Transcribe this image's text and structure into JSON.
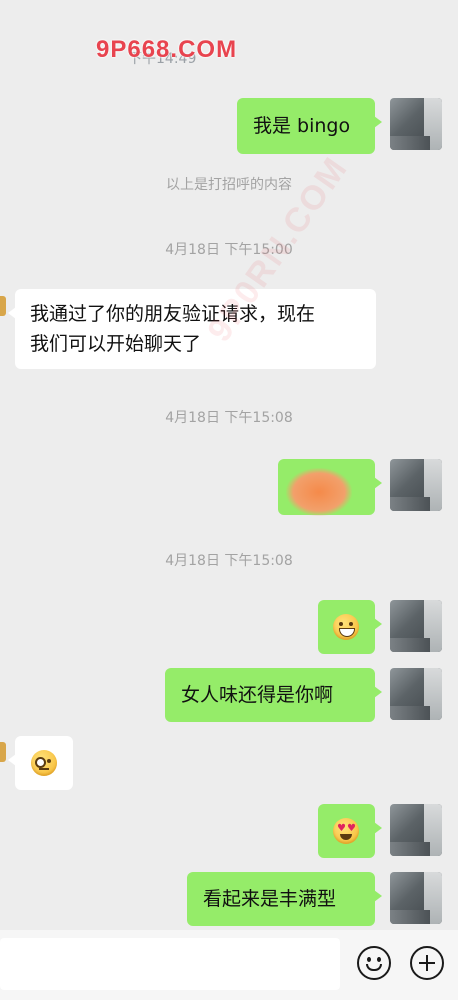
{
  "watermark": {
    "brand": "9P668.COM",
    "faint_time": "下午14:49",
    "diagonal": "9P0RN.COM"
  },
  "messages": [
    {
      "side": "me",
      "text": "我是 bingo"
    },
    {
      "type": "system",
      "text": "以上是打招呼的内容"
    },
    {
      "type": "time",
      "text": "4月18日 下午15:00"
    },
    {
      "side": "them",
      "lines": [
        "我通过了你的朋友验证请求，现在",
        "我们可以开始聊天了"
      ]
    },
    {
      "type": "time",
      "text": "4月18日 下午15:08"
    },
    {
      "side": "me",
      "text": "",
      "redacted": true
    },
    {
      "type": "time",
      "text": "4月18日 下午15:08"
    },
    {
      "side": "me",
      "emoji": "grinning-face-emoji"
    },
    {
      "side": "me",
      "text": "女人味还得是你啊"
    },
    {
      "side": "them",
      "emoji": "monocle-face-emoji"
    },
    {
      "side": "me",
      "emoji": "heart-eyes-face-emoji"
    },
    {
      "side": "me",
      "text": "看起来是丰满型"
    }
  ],
  "input_bar": {
    "value": "",
    "buttons": [
      "emoji-icon",
      "plus-icon"
    ]
  },
  "colors": {
    "background": "#ededed",
    "my_bubble": "#95ec69",
    "their_bubble": "#ffffff",
    "time_text": "#a3a3a3"
  }
}
